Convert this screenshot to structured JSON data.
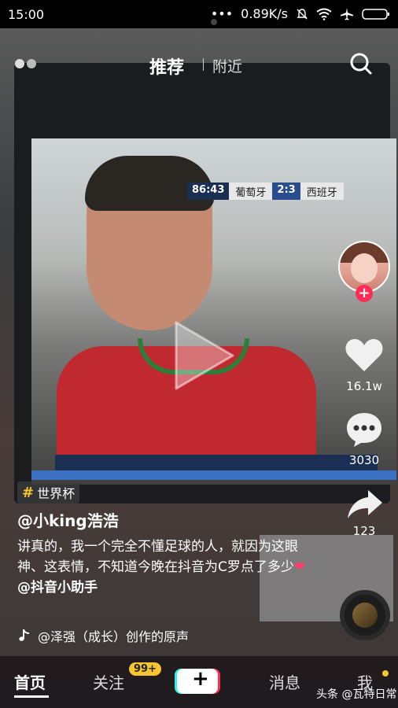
{
  "status_bar": {
    "time": "15:00",
    "network_speed": "0.89K/s"
  },
  "top_tabs": {
    "active": "推荐",
    "other": "附近"
  },
  "video_overlay": {
    "clock": "86:43",
    "team_left": "葡萄牙",
    "score": "2:3",
    "team_right": "西班牙"
  },
  "right_rail": {
    "likes": "16.1w",
    "comments": "3030",
    "shares": "123"
  },
  "post": {
    "hashtag": "世界杯",
    "username": "@小king浩浩",
    "caption_part1": "讲真的，我一个完全不懂足球的人，就因为这眼神、这表情，不知道今晚在抖音为C罗点了多少",
    "caption_heart": "❤",
    "caption_mention": "@抖音小助手",
    "music": "@泽强（成长）创作的原声"
  },
  "bottom_nav": {
    "home": "首页",
    "follow": "关注",
    "follow_badge": "99+",
    "plus": "+",
    "messages": "消息",
    "me": "我"
  },
  "watermark": "头条 @瓦特日常",
  "colors": {
    "accent_pink": "#ff2c55",
    "badge_yellow": "#f7c531"
  }
}
